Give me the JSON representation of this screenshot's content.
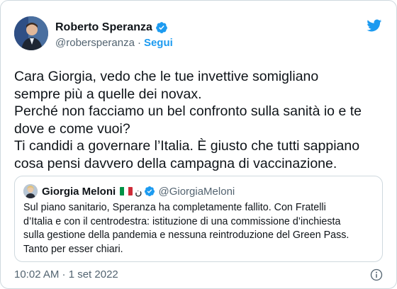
{
  "author": {
    "name": "Roberto Speranza",
    "handle": "@robersperanza",
    "separator": "·",
    "follow_label": "Segui"
  },
  "tweet": {
    "text": "Cara Giorgia, vedo che le tue invettive somigliano\nsempre più a quelle dei novax.\nPerché non facciamo un bel confronto sulla sanità io e te\ndove e come vuoi?\nTi candidi a governare l’Italia. È giusto che tutti sappiano\ncosa pensi davvero della campagna di vaccinazione."
  },
  "quoted": {
    "name": "Giorgia Meloni",
    "emoji_text": "ن",
    "handle": "@GiorgiaMeloni",
    "text": "Sul piano sanitario, Speranza ha completamente fallito. Con Fratelli\nd’Italia e con il centrodestra: istituzione di una commissione d’inchiesta\nsulla gestione della pandemia e nessuna reintroduzione del Green Pass.\nTanto per esser chiari."
  },
  "footer": {
    "timestamp": "10:02 AM · 1 set 2022"
  },
  "colors": {
    "accent": "#1d9bf0",
    "secondary_text": "#536471",
    "border": "#cfd9de"
  },
  "icons": {
    "verified": "verified-badge-icon",
    "twitter": "twitter-bird-icon",
    "info": "info-icon",
    "flag": "italy-flag-icon"
  }
}
